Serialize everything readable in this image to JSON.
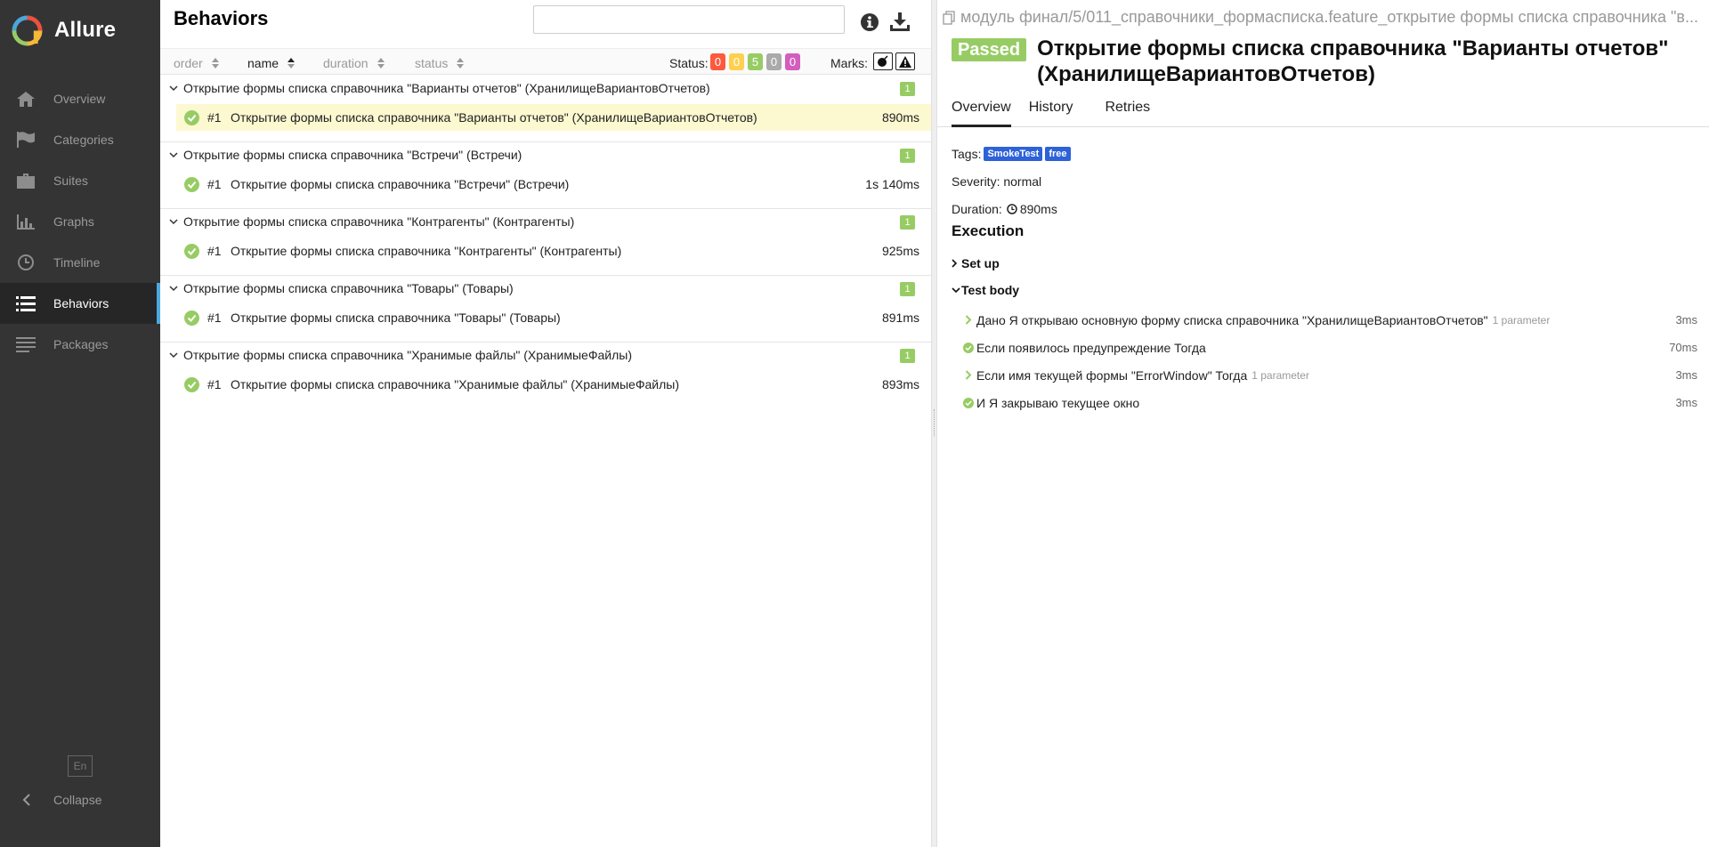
{
  "brand": {
    "name": "Allure"
  },
  "sidebar": {
    "items": [
      {
        "label": "Overview",
        "icon": "home-icon"
      },
      {
        "label": "Categories",
        "icon": "flag-icon"
      },
      {
        "label": "Suites",
        "icon": "briefcase-icon"
      },
      {
        "label": "Graphs",
        "icon": "bar-chart-icon"
      },
      {
        "label": "Timeline",
        "icon": "clock-icon"
      },
      {
        "label": "Behaviors",
        "icon": "list-icon",
        "active": true
      },
      {
        "label": "Packages",
        "icon": "packages-icon"
      }
    ],
    "language": "En",
    "collapse_label": "Collapse"
  },
  "behaviors": {
    "title": "Behaviors",
    "search_value": "",
    "sort": {
      "order": "order",
      "name": "name",
      "duration": "duration",
      "status": "status"
    },
    "status_label": "Status:",
    "status_counts": [
      {
        "value": "0",
        "color": "#fd5a3e"
      },
      {
        "value": "0",
        "color": "#ffd050"
      },
      {
        "value": "5",
        "color": "#97cc64"
      },
      {
        "value": "0",
        "color": "#aaaaaa"
      },
      {
        "value": "0",
        "color": "#d35ebe"
      }
    ],
    "marks_label": "Marks:",
    "groups": [
      {
        "name": "Открытие формы списка справочника \"Варианты отчетов\" (ХранилищеВариантовОтчетов)",
        "count": "1",
        "test": {
          "num": "#1",
          "name": "Открытие формы списка справочника \"Варианты отчетов\" (ХранилищеВариантовОтчетов)",
          "duration": "890ms"
        }
      },
      {
        "name": "Открытие формы списка справочника \"Встречи\" (Встречи)",
        "count": "1",
        "test": {
          "num": "#1",
          "name": "Открытие формы списка справочника \"Встречи\" (Встречи)",
          "duration": "1s 140ms"
        }
      },
      {
        "name": "Открытие формы списка справочника \"Контрагенты\" (Контрагенты)",
        "count": "1",
        "test": {
          "num": "#1",
          "name": "Открытие формы списка справочника \"Контрагенты\" (Контрагенты)",
          "duration": "925ms"
        }
      },
      {
        "name": "Открытие формы списка справочника \"Товары\" (Товары)",
        "count": "1",
        "test": {
          "num": "#1",
          "name": "Открытие формы списка справочника \"Товары\" (Товары)",
          "duration": "891ms"
        }
      },
      {
        "name": "Открытие формы списка справочника \"Хранимые файлы\" (ХранимыеФайлы)",
        "count": "1",
        "test": {
          "num": "#1",
          "name": "Открытие формы списка справочника \"Хранимые файлы\" (ХранимыеФайлы)",
          "duration": "893ms"
        }
      }
    ]
  },
  "detail": {
    "path": "модуль финал/5/011_справочники_формасписка.feature_открытие формы списка справочника \"в...",
    "status": "Passed",
    "title": "Открытие формы списка справочника \"Варианты отчетов\" (ХранилищеВариантовОтчетов)",
    "tabs": [
      "Overview",
      "History",
      "Retries"
    ],
    "tags_label": "Tags:",
    "tags": [
      "SmokeTest",
      "free"
    ],
    "severity": "Severity: normal",
    "duration_label": "Duration:",
    "duration": "890ms",
    "execution_title": "Execution",
    "setup_label": "Set up",
    "test_body_label": "Test body",
    "steps": [
      {
        "name": "Дано Я открываю основную форму списка справочника \"ХранилищеВариантовОтчетов\"",
        "param": "1 parameter",
        "duration": "3ms",
        "icon": "chevron-right-icon"
      },
      {
        "name": "Если появилось предупреждение Тогда",
        "param": "",
        "duration": "70ms",
        "icon": "check-circle-icon"
      },
      {
        "name": "Если имя текущей формы \"ErrorWindow\" Тогда",
        "param": "1 parameter",
        "duration": "3ms",
        "icon": "chevron-right-icon"
      },
      {
        "name": "И Я закрываю текущее окно",
        "param": "",
        "duration": "3ms",
        "icon": "check-circle-icon"
      }
    ]
  }
}
